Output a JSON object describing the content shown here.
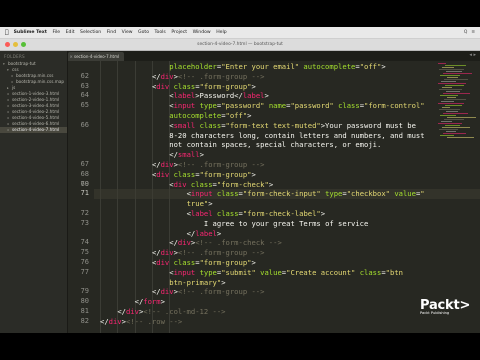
{
  "menubar": {
    "apple": "",
    "items": [
      "Sublime Text",
      "File",
      "Edit",
      "Selection",
      "Find",
      "View",
      "Goto",
      "Tools",
      "Project",
      "Window",
      "Help"
    ],
    "right": [
      "Q",
      "≡"
    ]
  },
  "titlebar": {
    "title": "section-4-video-7.html — bootstrap-tut"
  },
  "tab": {
    "label": "section-4-video-7.html",
    "close": "×",
    "nav": "◂ ▸"
  },
  "sidebar": {
    "heading": "FOLDERS",
    "items": [
      {
        "label": "bootstrap-tut",
        "kind": "folder-open",
        "depth": 0
      },
      {
        "label": "css",
        "kind": "folder-open",
        "depth": 1
      },
      {
        "label": "bootstrap.min.css",
        "kind": "file",
        "depth": 2
      },
      {
        "label": "bootstrap.min.css.map",
        "kind": "file",
        "depth": 2
      },
      {
        "label": "js",
        "kind": "folder",
        "depth": 1
      },
      {
        "label": "section-1-video-3.html",
        "kind": "file",
        "depth": 1
      },
      {
        "label": "section-2-video-1.html",
        "kind": "file",
        "depth": 1
      },
      {
        "label": "section-3-video-4.html",
        "kind": "file",
        "depth": 1
      },
      {
        "label": "section-4-video-2.html",
        "kind": "file",
        "depth": 1
      },
      {
        "label": "section-4-video-5.html",
        "kind": "file",
        "depth": 1
      },
      {
        "label": "section-4-video-6.html",
        "kind": "file",
        "depth": 1
      },
      {
        "label": "section-4-video-7.html",
        "kind": "file",
        "depth": 1,
        "selected": true
      }
    ]
  },
  "editor": {
    "current_line": 71,
    "lines": [
      {
        "n": "",
        "indent": 16,
        "tokens": [
          [
            "attr",
            "placeholder"
          ],
          [
            "plain",
            "="
          ],
          [
            "str",
            "\"Enter your email\""
          ],
          [
            "plain",
            " "
          ],
          [
            "attr",
            "autocomplete"
          ],
          [
            "plain",
            "="
          ],
          [
            "str",
            "\"off\""
          ],
          [
            "plain",
            ">"
          ]
        ]
      },
      {
        "n": "62",
        "indent": 12,
        "tokens": [
          [
            "plain",
            "</"
          ],
          [
            "tag",
            "div"
          ],
          [
            "plain",
            ">"
          ],
          [
            "com",
            "<!-- .form-group -->"
          ]
        ]
      },
      {
        "n": "63",
        "indent": 12,
        "tokens": [
          [
            "plain",
            "<"
          ],
          [
            "tag",
            "div"
          ],
          [
            "plain",
            " "
          ],
          [
            "attr",
            "class"
          ],
          [
            "plain",
            "="
          ],
          [
            "str",
            "\"form-group\""
          ],
          [
            "plain",
            ">"
          ]
        ]
      },
      {
        "n": "64",
        "indent": 16,
        "tokens": [
          [
            "plain",
            "<"
          ],
          [
            "tag",
            "label"
          ],
          [
            "plain",
            ">Password</"
          ],
          [
            "tag",
            "label"
          ],
          [
            "plain",
            ">"
          ]
        ]
      },
      {
        "n": "65",
        "indent": 16,
        "tokens": [
          [
            "plain",
            "<"
          ],
          [
            "tag",
            "input"
          ],
          [
            "plain",
            " "
          ],
          [
            "attr",
            "type"
          ],
          [
            "plain",
            "="
          ],
          [
            "str",
            "\"password\""
          ],
          [
            "plain",
            " "
          ],
          [
            "attr",
            "name"
          ],
          [
            "plain",
            "="
          ],
          [
            "str",
            "\"password\""
          ],
          [
            "plain",
            " "
          ],
          [
            "attr",
            "class"
          ],
          [
            "plain",
            "="
          ],
          [
            "str",
            "\"form-control\""
          ]
        ]
      },
      {
        "n": "",
        "indent": 16,
        "tokens": [
          [
            "attr",
            "autocomplete"
          ],
          [
            "plain",
            "="
          ],
          [
            "str",
            "\"off\""
          ],
          [
            "plain",
            ">"
          ]
        ]
      },
      {
        "n": "66",
        "indent": 16,
        "tokens": [
          [
            "plain",
            "<"
          ],
          [
            "tag",
            "small"
          ],
          [
            "plain",
            " "
          ],
          [
            "attr",
            "class"
          ],
          [
            "plain",
            "="
          ],
          [
            "str",
            "\"form-text text-muted\""
          ],
          [
            "plain",
            ">Your password must be"
          ]
        ]
      },
      {
        "n": "",
        "indent": 16,
        "tokens": [
          [
            "plain",
            "8-20 characters long, contain letters and numbers, and must"
          ]
        ]
      },
      {
        "n": "",
        "indent": 16,
        "tokens": [
          [
            "plain",
            "not contain spaces, special characters, or emoji."
          ]
        ]
      },
      {
        "n": "",
        "indent": 16,
        "tokens": [
          [
            "plain",
            "</"
          ],
          [
            "tag",
            "small"
          ],
          [
            "plain",
            ">"
          ]
        ]
      },
      {
        "n": "67",
        "indent": 12,
        "tokens": [
          [
            "plain",
            "</"
          ],
          [
            "tag",
            "div"
          ],
          [
            "plain",
            ">"
          ],
          [
            "com",
            "<!-- .form-group -->"
          ]
        ]
      },
      {
        "n": "68",
        "indent": 12,
        "tokens": [
          [
            "plain",
            "<"
          ],
          [
            "tag",
            "div"
          ],
          [
            "plain",
            " "
          ],
          [
            "attr",
            "class"
          ],
          [
            "plain",
            "="
          ],
          [
            "str",
            "\"form-group\""
          ],
          [
            "plain",
            ">"
          ]
        ]
      },
      {
        "n": "69",
        "indent": 16,
        "tokens": [
          [
            "plain",
            "<"
          ],
          [
            "tag",
            "div"
          ],
          [
            "plain",
            " "
          ],
          [
            "attr",
            "class"
          ],
          [
            "plain",
            "="
          ],
          [
            "str",
            "\"form-check\""
          ],
          [
            "plain",
            ">"
          ]
        ]
      },
      {
        "n": "70",
        "indent": 20,
        "tokens": [
          [
            "plain",
            "<"
          ],
          [
            "tag",
            "input"
          ],
          [
            "plain",
            " "
          ],
          [
            "attr",
            "class"
          ],
          [
            "plain",
            "="
          ],
          [
            "str",
            "\"form-check-input\""
          ],
          [
            "plain",
            " "
          ],
          [
            "attr",
            "type"
          ],
          [
            "plain",
            "="
          ],
          [
            "str",
            "\"checkbox\""
          ],
          [
            "plain",
            " "
          ],
          [
            "attr",
            "value"
          ],
          [
            "plain",
            "="
          ],
          [
            "str",
            "\""
          ]
        ]
      },
      {
        "n": "",
        "indent": 20,
        "tokens": [
          [
            "str",
            "true\""
          ],
          [
            "plain",
            ">"
          ]
        ]
      },
      {
        "n": "72",
        "indent": 20,
        "tokens": [
          [
            "plain",
            "<"
          ],
          [
            "tag",
            "label"
          ],
          [
            "plain",
            " "
          ],
          [
            "attr",
            "class"
          ],
          [
            "plain",
            "="
          ],
          [
            "str",
            "\"form-check-label\""
          ],
          [
            "plain",
            ">"
          ]
        ]
      },
      {
        "n": "73",
        "indent": 24,
        "tokens": [
          [
            "plain",
            "I agree to your great Terms of service"
          ]
        ]
      },
      {
        "n": "",
        "indent": 20,
        "tokens": [
          [
            "plain",
            "</"
          ],
          [
            "tag",
            "label"
          ],
          [
            "plain",
            ">"
          ]
        ]
      },
      {
        "n": "74",
        "indent": 16,
        "tokens": [
          [
            "plain",
            "</"
          ],
          [
            "tag",
            "div"
          ],
          [
            "plain",
            ">"
          ],
          [
            "com",
            "<!-- .form-check -->"
          ]
        ]
      },
      {
        "n": "75",
        "indent": 12,
        "tokens": [
          [
            "plain",
            "</"
          ],
          [
            "tag",
            "div"
          ],
          [
            "plain",
            ">"
          ],
          [
            "com",
            "<!-- .form-group -->"
          ]
        ]
      },
      {
        "n": "76",
        "indent": 12,
        "tokens": [
          [
            "plain",
            "<"
          ],
          [
            "tag",
            "div"
          ],
          [
            "plain",
            " "
          ],
          [
            "attr",
            "class"
          ],
          [
            "plain",
            "="
          ],
          [
            "str",
            "\"form-group\""
          ],
          [
            "plain",
            ">"
          ]
        ]
      },
      {
        "n": "77",
        "indent": 16,
        "tokens": [
          [
            "plain",
            "<"
          ],
          [
            "tag",
            "input"
          ],
          [
            "plain",
            " "
          ],
          [
            "attr",
            "type"
          ],
          [
            "plain",
            "="
          ],
          [
            "str",
            "\"submit\""
          ],
          [
            "plain",
            " "
          ],
          [
            "attr",
            "value"
          ],
          [
            "plain",
            "="
          ],
          [
            "str",
            "\"Create account\""
          ],
          [
            "plain",
            " "
          ],
          [
            "attr",
            "class"
          ],
          [
            "plain",
            "="
          ],
          [
            "str",
            "\"btn"
          ]
        ]
      },
      {
        "n": "",
        "indent": 16,
        "tokens": [
          [
            "str",
            "btn-primary\""
          ],
          [
            "plain",
            ">"
          ]
        ]
      },
      {
        "n": "79",
        "indent": 12,
        "tokens": [
          [
            "plain",
            "</"
          ],
          [
            "tag",
            "div"
          ],
          [
            "plain",
            ">"
          ],
          [
            "com",
            "<!-- .form-group -->"
          ]
        ]
      },
      {
        "n": "80",
        "indent": 8,
        "tokens": [
          [
            "plain",
            "</"
          ],
          [
            "tag",
            "form"
          ],
          [
            "plain",
            ">"
          ]
        ]
      },
      {
        "n": "81",
        "indent": 4,
        "tokens": [
          [
            "plain",
            "</"
          ],
          [
            "tag",
            "div"
          ],
          [
            "plain",
            ">"
          ],
          [
            "com",
            "<!-- .col-md-12 -->"
          ]
        ]
      },
      {
        "n": "82",
        "indent": 0,
        "tokens": [
          [
            "plain",
            "</"
          ],
          [
            "tag",
            "div"
          ],
          [
            "plain",
            ">"
          ],
          [
            "com",
            "<!-- .row -->"
          ]
        ]
      }
    ]
  },
  "packt": {
    "logo": "Packt",
    "caret": ">",
    "tagline": "Packt Publishing"
  },
  "colors": {
    "bg": "#272822",
    "tag": "#f92672",
    "attr": "#a6e22e",
    "string": "#e6db74",
    "comment": "#75715e",
    "text": "#f8f8f2",
    "gutter": "#90908a"
  },
  "icons": [
    "apple-icon",
    "search-icon",
    "menu-icon",
    "folder-icon",
    "file-icon",
    "close-icon"
  ]
}
